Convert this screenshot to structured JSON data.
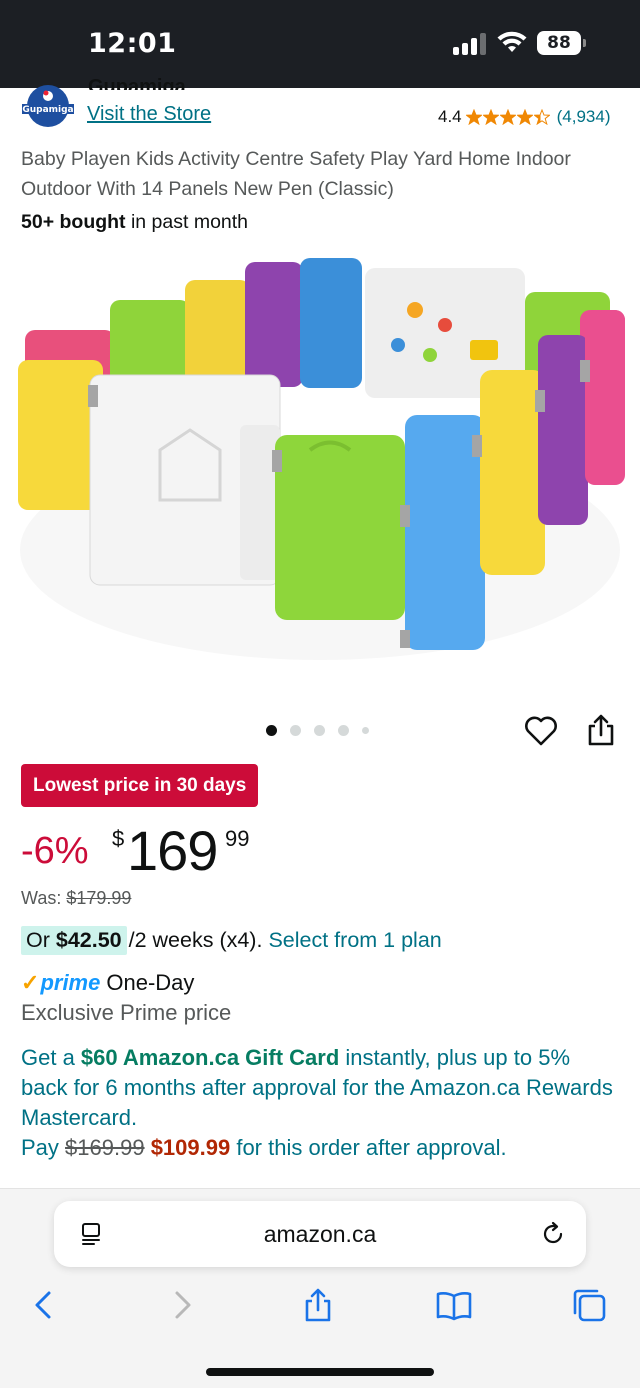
{
  "status_bar": {
    "time": "12:01",
    "battery": "88"
  },
  "store": {
    "brand": "Gupamiga",
    "logo_text": "Gupamiga",
    "visit_store": "Visit the Store",
    "rating": "4.4",
    "rating_count": "(4,934)",
    "stars_value": 4.4,
    "star_color": "#f08804"
  },
  "product": {
    "title": "Baby Playen Kids Activity Centre Safety Play Yard Home Indoor Outdoor With 14 Panels New Pen (Classic)",
    "bought_bold": "50+ bought",
    "bought_rest": " in past month",
    "image_dots": 5,
    "active_dot": 0
  },
  "pricing": {
    "deal_badge": "Lowest price in 30 days",
    "discount": "-6%",
    "currency": "$",
    "whole": "169",
    "fraction": "99",
    "was_label": "Was: ",
    "was_price": "$179.99",
    "plan_or": "Or ",
    "plan_amount": "$42.50",
    "plan_text": " /2 weeks (x4).",
    "plan_link": "Select from 1 plan"
  },
  "prime": {
    "check": "✓",
    "word": "prime",
    "delivery": "One-Day",
    "exclusive": "Exclusive Prime price"
  },
  "card_offer": {
    "p1": "Get a ",
    "gift": "$60 Amazon.ca Gift Card",
    "p2": " instantly, plus up to 5% back for 6 months after approval for the Amazon.ca Rewards Mastercard.",
    "p3": "Pay ",
    "old_price": "$169.99",
    "new_price": "$109.99",
    "p4": " for this order after approval."
  },
  "browser": {
    "url": "amazon.ca"
  },
  "colors": {
    "link": "#007185",
    "deal_red": "#cc0c39",
    "prime_blue": "#1399ff",
    "gift_green": "#067d62",
    "price_red": "#b12704"
  },
  "icons": [
    "signal-icon",
    "wifi-icon",
    "battery-icon",
    "heart-icon",
    "share-icon",
    "reader-icon",
    "reload-icon",
    "back-icon",
    "forward-icon",
    "share-sheet-icon",
    "bookmarks-icon",
    "tabs-icon"
  ]
}
